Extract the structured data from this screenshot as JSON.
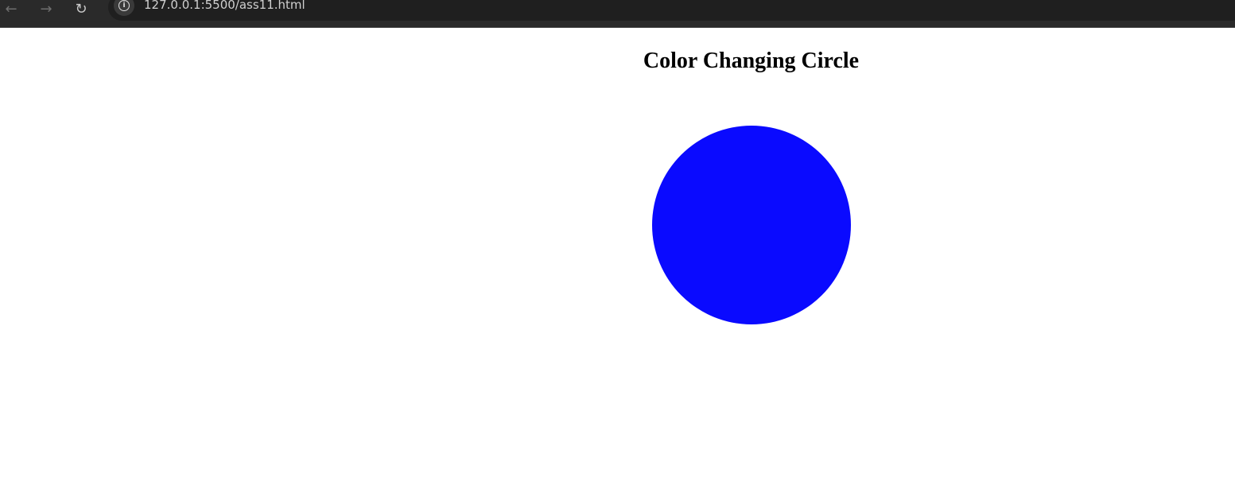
{
  "browser": {
    "back_icon": "arrow-left-icon",
    "forward_icon": "arrow-right-icon",
    "reload_icon": "reload-icon",
    "site_info_icon": "info-icon",
    "url": "127.0.0.1:5500/ass11.html"
  },
  "page": {
    "heading": "Color Changing Circle",
    "circle_color": "#0a0aff"
  }
}
